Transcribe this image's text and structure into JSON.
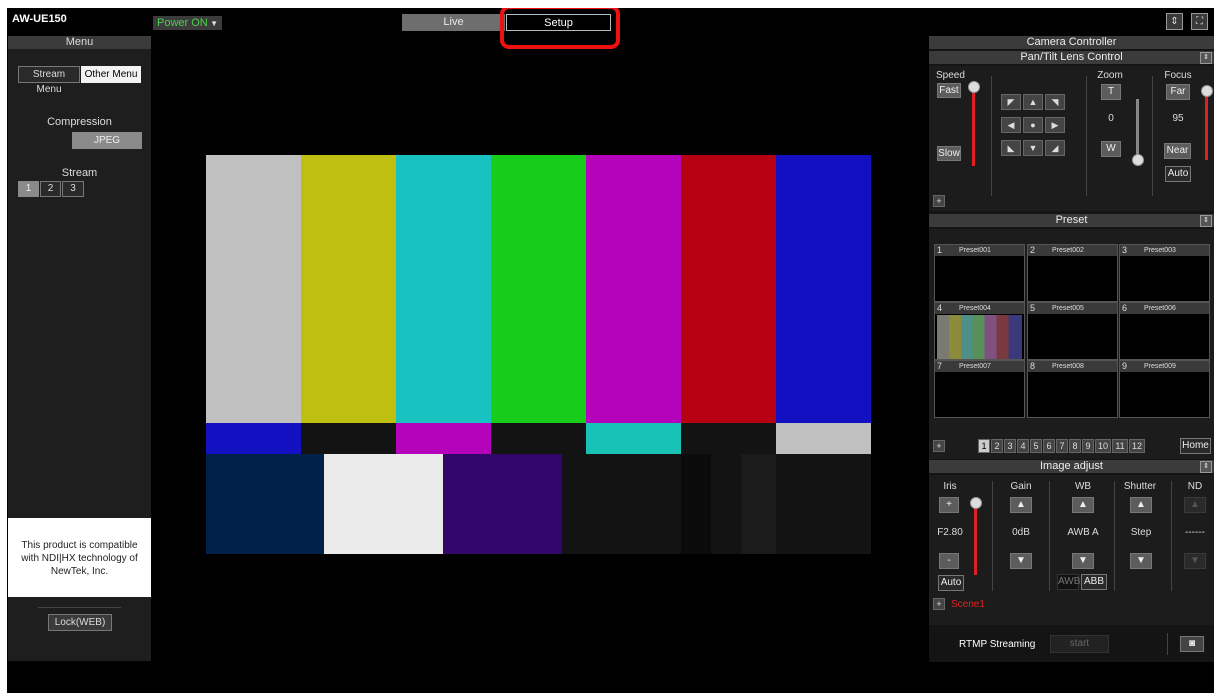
{
  "topbar": {
    "model": "AW-UE150",
    "power": "Power ON",
    "tabs": {
      "live": "Live",
      "setup": "Setup"
    }
  },
  "menu": {
    "title": "Menu",
    "stream_menu": "Stream Menu",
    "other_menu": "Other Menu",
    "compression_label": "Compression",
    "compression_value": "JPEG",
    "stream_label": "Stream",
    "streams": [
      "1",
      "2",
      "3"
    ],
    "notice": [
      "This product is compatible",
      "with NDI|HX technology of",
      "NewTek, Inc."
    ],
    "lock": "Lock(WEB)"
  },
  "controller": {
    "title": "Camera Controller",
    "pantilt_title": "Pan/Tilt Lens Control",
    "speed": {
      "label": "Speed",
      "fast": "Fast",
      "slow": "Slow"
    },
    "zoom": {
      "label": "Zoom",
      "tele": "T",
      "value": "0",
      "wide": "W"
    },
    "focus": {
      "label": "Focus",
      "far": "Far",
      "value": "95",
      "near": "Near",
      "auto": "Auto"
    },
    "preset_title": "Preset",
    "presets": [
      {
        "num": "1",
        "name": "Preset001"
      },
      {
        "num": "2",
        "name": "Preset002"
      },
      {
        "num": "3",
        "name": "Preset003"
      },
      {
        "num": "4",
        "name": "Preset004"
      },
      {
        "num": "5",
        "name": "Preset005"
      },
      {
        "num": "6",
        "name": "Preset006"
      },
      {
        "num": "7",
        "name": "Preset007"
      },
      {
        "num": "8",
        "name": "Preset008"
      },
      {
        "num": "9",
        "name": "Preset009"
      }
    ],
    "pages": [
      "1",
      "2",
      "3",
      "4",
      "5",
      "6",
      "7",
      "8",
      "9",
      "10",
      "11",
      "12"
    ],
    "home": "Home",
    "image_adjust_title": "Image adjust",
    "iris": {
      "label": "Iris",
      "value": "F2.80",
      "auto": "Auto"
    },
    "gain": {
      "label": "Gain",
      "value": "0dB"
    },
    "wb": {
      "label": "WB",
      "value": "AWB A",
      "awb": "AWB",
      "abb": "ABB"
    },
    "shutter": {
      "label": "Shutter",
      "value": "Step"
    },
    "nd": {
      "label": "ND",
      "value": "------"
    },
    "scene": "Scene1",
    "rtmp_label": "RTMP Streaming",
    "rtmp_start": "start"
  },
  "colors": {
    "accent_red": "#e11",
    "power_green": "#4cd24c",
    "scene_red": "#e02020"
  }
}
